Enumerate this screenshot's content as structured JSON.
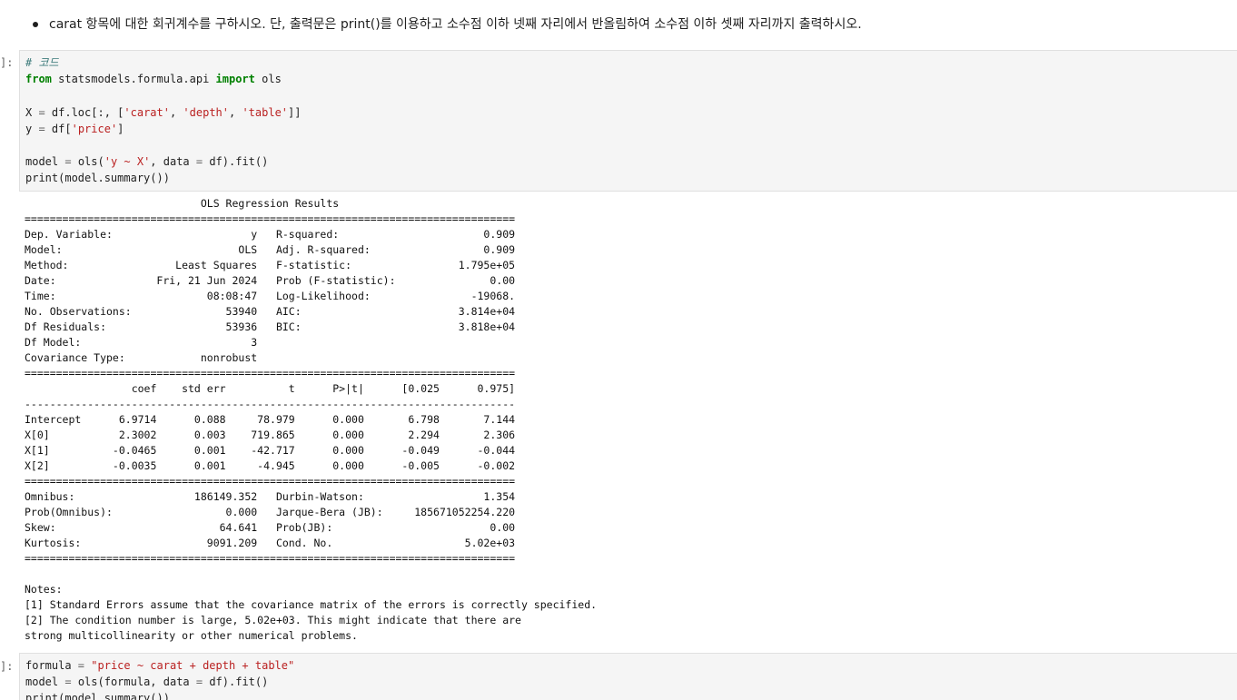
{
  "instruction": {
    "text": "carat 항목에 대한 회귀계수를 구하시오. 단, 출력문은 print()를 이용하고 소수점 이하 넷째 자리에서 반올림하여 소수점 이하 셋째 자리까지 출력하시오."
  },
  "cells": {
    "cell1_prompt": "]:",
    "cell2_prompt": "]:"
  },
  "code1": {
    "l1": "# 코드",
    "l2_kw1": "from",
    "l2_mod": " statsmodels.formula.api ",
    "l2_kw2": "import",
    "l2_name": " ols",
    "l4_a": "X ",
    "l4_op": "=",
    "l4_b": " df.loc[:, [",
    "l4_s1": "'carat'",
    "l4_c1": ", ",
    "l4_s2": "'depth'",
    "l4_c2": ", ",
    "l4_s3": "'table'",
    "l4_end": "]]",
    "l5_a": "y ",
    "l5_op": "=",
    "l5_b": " df[",
    "l5_s": "'price'",
    "l5_end": "]",
    "l7_a": "model ",
    "l7_op": "=",
    "l7_b": " ols(",
    "l7_s": "'y ~ X'",
    "l7_c": ", data ",
    "l7_op2": "=",
    "l7_end": " df).fit()",
    "l8": "print(model.summary())"
  },
  "output": {
    "text": "                            OLS Regression Results                            \n==============================================================================\nDep. Variable:                      y   R-squared:                       0.909\nModel:                            OLS   Adj. R-squared:                  0.909\nMethod:                 Least Squares   F-statistic:                 1.795e+05\nDate:                Fri, 21 Jun 2024   Prob (F-statistic):               0.00\nTime:                        08:08:47   Log-Likelihood:                -19068.\nNo. Observations:               53940   AIC:                         3.814e+04\nDf Residuals:                   53936   BIC:                         3.818e+04\nDf Model:                           3                                         \nCovariance Type:            nonrobust                                         \n==============================================================================\n                 coef    std err          t      P>|t|      [0.025      0.975]\n------------------------------------------------------------------------------\nIntercept      6.9714      0.088     78.979      0.000       6.798       7.144\nX[0]           2.3002      0.003    719.865      0.000       2.294       2.306\nX[1]          -0.0465      0.001    -42.717      0.000      -0.049      -0.044\nX[2]          -0.0035      0.001     -4.945      0.000      -0.005      -0.002\n==============================================================================\nOmnibus:                   186149.352   Durbin-Watson:                   1.354\nProb(Omnibus):                  0.000   Jarque-Bera (JB):     185671052254.220\nSkew:                          64.641   Prob(JB):                         0.00\nKurtosis:                    9091.209   Cond. No.                     5.02e+03\n==============================================================================\n\nNotes:\n[1] Standard Errors assume that the covariance matrix of the errors is correctly specified.\n[2] The condition number is large, 5.02e+03. This might indicate that there are\nstrong multicollinearity or other numerical problems."
  },
  "code2": {
    "l1_a": "formula ",
    "l1_op": "=",
    "l1_sp": " ",
    "l1_s": "\"price ~ carat + depth + table\"",
    "l2_a": "model ",
    "l2_op": "=",
    "l2_b": " ols(formula, data ",
    "l2_op2": "=",
    "l2_end": " df).fit()",
    "l3": "print(model.summary())"
  }
}
